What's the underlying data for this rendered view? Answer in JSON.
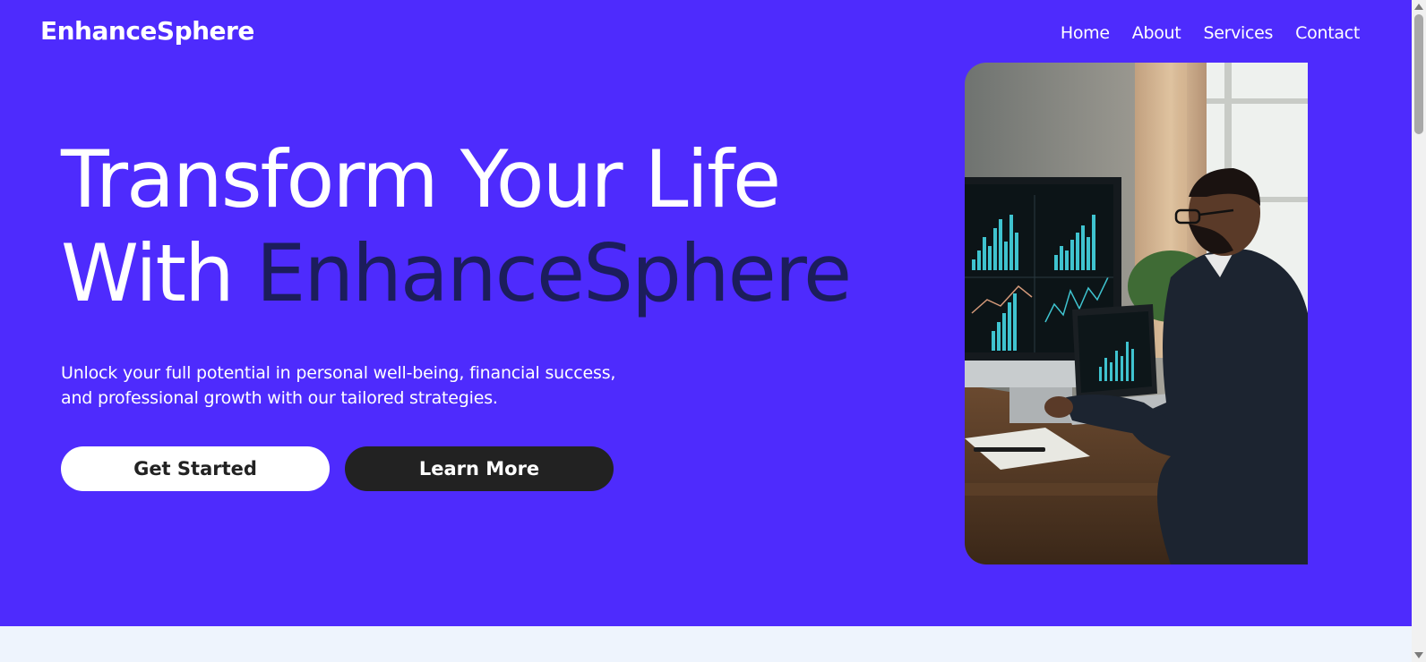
{
  "brand": {
    "name": "EnhanceSphere"
  },
  "nav": {
    "items": [
      "Home",
      "About",
      "Services",
      "Contact"
    ]
  },
  "hero": {
    "headline_line1": "Transform Your Life",
    "headline_with": "With ",
    "headline_accent": "EnhanceSphere",
    "subtitle_line1": "Unlock your full potential in personal well-being, financial success,",
    "subtitle_line2": "and professional growth with our tailored strategies.",
    "primary_button": "Get Started",
    "secondary_button": "Learn More"
  },
  "colors": {
    "hero_background": "#4e2bfd",
    "accent_text": "#1c1d5c",
    "page_background": "#eef4fd",
    "primary_button_bg": "#ffffff",
    "secondary_button_bg": "#222222"
  }
}
